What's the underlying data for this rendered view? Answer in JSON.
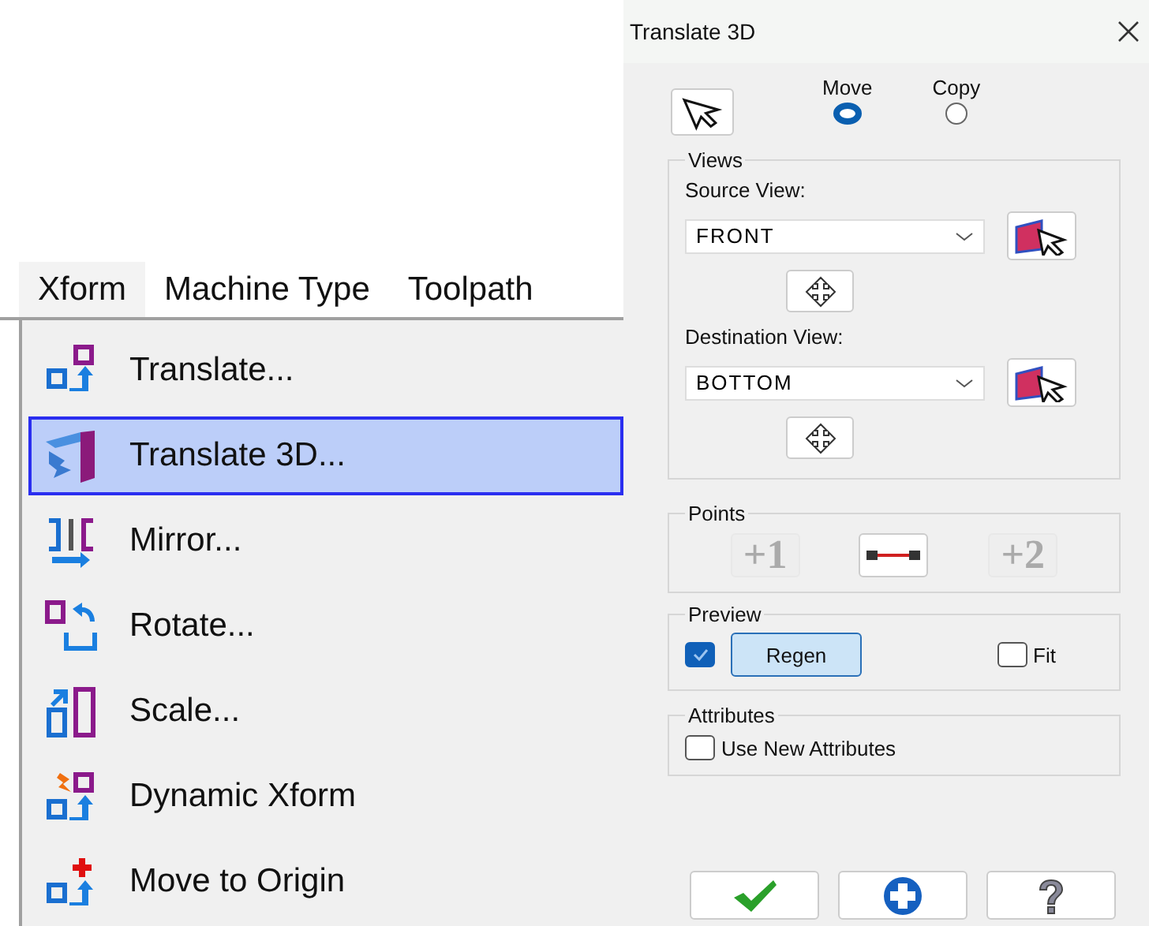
{
  "menu_bar": {
    "items": [
      {
        "label": "Xform",
        "selected": true
      },
      {
        "label": "Machine Type",
        "selected": false
      },
      {
        "label": "Toolpath",
        "selected": false
      }
    ]
  },
  "menu": {
    "items": [
      {
        "label": "Translate...",
        "kind": "translate",
        "selected": false
      },
      {
        "label": "Translate 3D...",
        "kind": "translate3d",
        "selected": true
      },
      {
        "label": "Mirror...",
        "kind": "mirror",
        "selected": false
      },
      {
        "label": "Rotate...",
        "kind": "rotate",
        "selected": false
      },
      {
        "label": "Scale...",
        "kind": "scale",
        "selected": false
      },
      {
        "label": "Dynamic Xform",
        "kind": "dynamic",
        "selected": false
      },
      {
        "label": "Move to Origin",
        "kind": "origin",
        "selected": false
      }
    ]
  },
  "dialog": {
    "title": "Translate 3D",
    "modes": [
      {
        "label": "Move",
        "selected": true
      },
      {
        "label": "Copy",
        "selected": false
      }
    ],
    "views": {
      "title": "Views",
      "fields": [
        {
          "label": "Source View:",
          "value": "FRONT"
        },
        {
          "label": "Destination View:",
          "value": "BOTTOM"
        }
      ]
    },
    "points": {
      "title": "Points",
      "buttons": [
        {
          "kind": "text",
          "text": "+1",
          "disabled": true
        },
        {
          "kind": "line",
          "disabled": false
        },
        {
          "kind": "text",
          "text": "+2",
          "disabled": true
        }
      ]
    },
    "preview": {
      "title": "Preview",
      "checked": true,
      "button": "Regen",
      "fit": {
        "label": "Fit",
        "checked": false
      }
    },
    "attributes": {
      "title": "Attributes",
      "option": {
        "label": "Use New Attributes",
        "checked": false
      }
    }
  }
}
